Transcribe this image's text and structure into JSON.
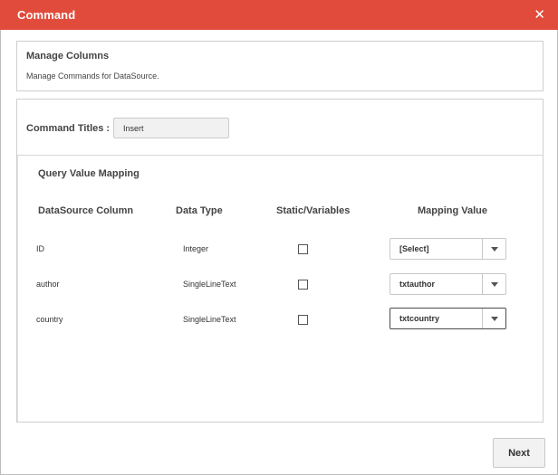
{
  "window": {
    "title": "Command",
    "close_glyph": "✕"
  },
  "manage": {
    "title": "Manage Columns",
    "description": "Manage Commands for DataSource."
  },
  "command": {
    "label": "Command Titles :",
    "value": "Insert"
  },
  "mapping": {
    "title": "Query Value Mapping",
    "headers": {
      "datasource_column": "DataSource Column",
      "data_type": "Data Type",
      "static_variables": "Static/Variables",
      "mapping_value": "Mapping Value"
    },
    "rows": [
      {
        "column": "ID",
        "type": "Integer",
        "static": false,
        "mapping": "[Select]"
      },
      {
        "column": "author",
        "type": "SingleLineText",
        "static": false,
        "mapping": "txtauthor"
      },
      {
        "column": "country",
        "type": "SingleLineText",
        "static": false,
        "mapping": "txtcountry"
      }
    ]
  },
  "footer": {
    "next_label": "Next"
  },
  "colors": {
    "titlebar": "#e14b3b"
  }
}
